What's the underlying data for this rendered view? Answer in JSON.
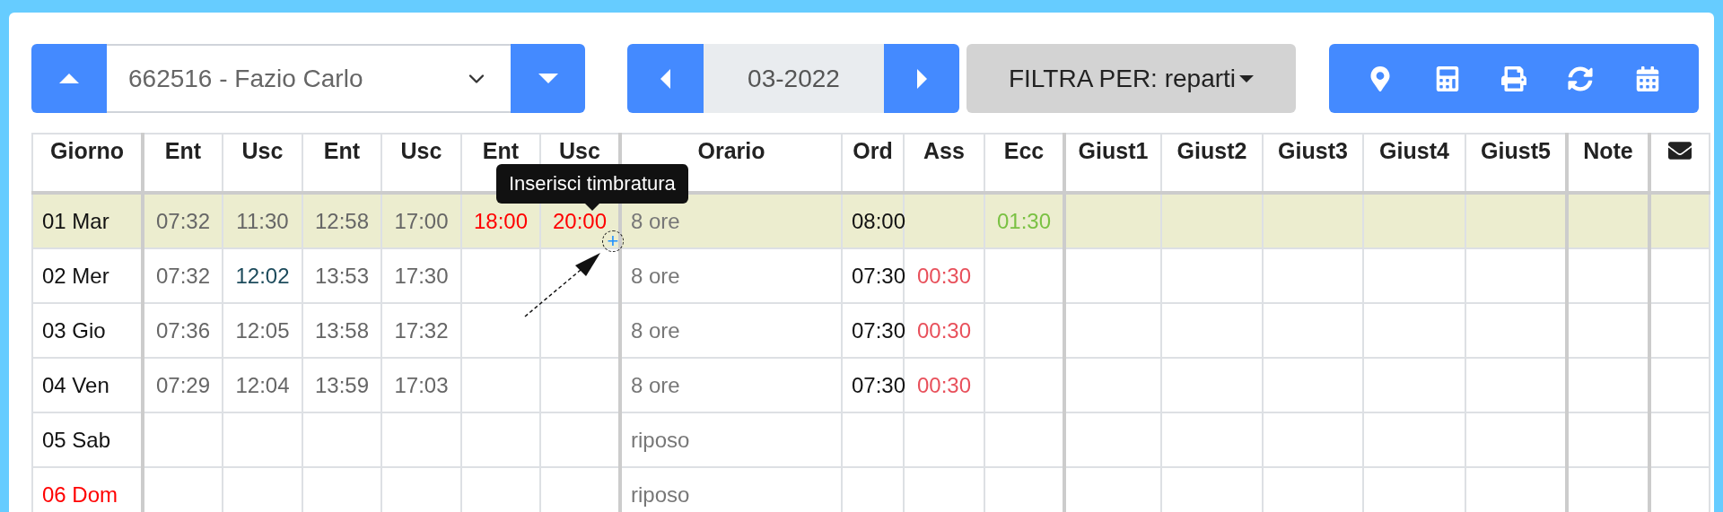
{
  "employee_selector": {
    "value": "662516 - Fazio Carlo"
  },
  "period": {
    "value": "03-2022"
  },
  "filter_button": {
    "label": "FILTRA PER: reparti"
  },
  "table": {
    "columns": [
      "Giorno",
      "Ent",
      "Usc",
      "Ent",
      "Usc",
      "Ent",
      "Usc",
      "Orario",
      "Ord",
      "Ass",
      "Ecc",
      "Giust1",
      "Giust2",
      "Giust3",
      "Giust4",
      "Giust5",
      "Note"
    ],
    "rows": [
      {
        "selected": true,
        "cells": [
          {
            "text": "01 Mar",
            "kind": "day"
          },
          {
            "text": "07:32",
            "kind": "time"
          },
          {
            "text": "11:30",
            "kind": "time"
          },
          {
            "text": "12:58",
            "kind": "time"
          },
          {
            "text": "17:00",
            "kind": "time"
          },
          {
            "text": "18:00",
            "kind": "extra"
          },
          {
            "text": "20:00",
            "kind": "extra"
          },
          {
            "text": "8 ore",
            "kind": "schedule"
          },
          {
            "text": "08:00",
            "kind": "hours"
          },
          null,
          {
            "text": "01:30",
            "kind": "surplus"
          },
          null,
          null,
          null,
          null,
          null,
          null
        ]
      },
      {
        "selected": false,
        "cells": [
          {
            "text": "02 Mer",
            "kind": "day"
          },
          {
            "text": "07:32",
            "kind": "time"
          },
          {
            "text": "12:02",
            "kind": "edited"
          },
          {
            "text": "13:53",
            "kind": "time"
          },
          {
            "text": "17:30",
            "kind": "time"
          },
          null,
          null,
          {
            "text": "8 ore",
            "kind": "schedule"
          },
          {
            "text": "07:30",
            "kind": "hours"
          },
          {
            "text": "00:30",
            "kind": "deficit"
          },
          null,
          null,
          null,
          null,
          null,
          null,
          null
        ]
      },
      {
        "selected": false,
        "cells": [
          {
            "text": "03 Gio",
            "kind": "day"
          },
          {
            "text": "07:36",
            "kind": "time"
          },
          {
            "text": "12:05",
            "kind": "time"
          },
          {
            "text": "13:58",
            "kind": "time"
          },
          {
            "text": "17:32",
            "kind": "time"
          },
          null,
          null,
          {
            "text": "8 ore",
            "kind": "schedule"
          },
          {
            "text": "07:30",
            "kind": "hours"
          },
          {
            "text": "00:30",
            "kind": "deficit"
          },
          null,
          null,
          null,
          null,
          null,
          null,
          null
        ]
      },
      {
        "selected": false,
        "cells": [
          {
            "text": "04 Ven",
            "kind": "day"
          },
          {
            "text": "07:29",
            "kind": "time"
          },
          {
            "text": "12:04",
            "kind": "time"
          },
          {
            "text": "13:59",
            "kind": "time"
          },
          {
            "text": "17:03",
            "kind": "time"
          },
          null,
          null,
          {
            "text": "8 ore",
            "kind": "schedule"
          },
          {
            "text": "07:30",
            "kind": "hours"
          },
          {
            "text": "00:30",
            "kind": "deficit"
          },
          null,
          null,
          null,
          null,
          null,
          null,
          null
        ]
      },
      {
        "selected": false,
        "cells": [
          {
            "text": "05 Sab",
            "kind": "day"
          },
          null,
          null,
          null,
          null,
          null,
          null,
          {
            "text": "riposo",
            "kind": "schedule"
          },
          null,
          null,
          null,
          null,
          null,
          null,
          null,
          null,
          null
        ]
      },
      {
        "selected": false,
        "cells": [
          {
            "text": "06 Dom",
            "kind": "holiday"
          },
          null,
          null,
          null,
          null,
          null,
          null,
          {
            "text": "riposo",
            "kind": "schedule"
          },
          null,
          null,
          null,
          null,
          null,
          null,
          null,
          null,
          null
        ]
      }
    ]
  },
  "tooltip": {
    "text": "Inserisci timbratura"
  },
  "add_button": {
    "label": "+"
  }
}
